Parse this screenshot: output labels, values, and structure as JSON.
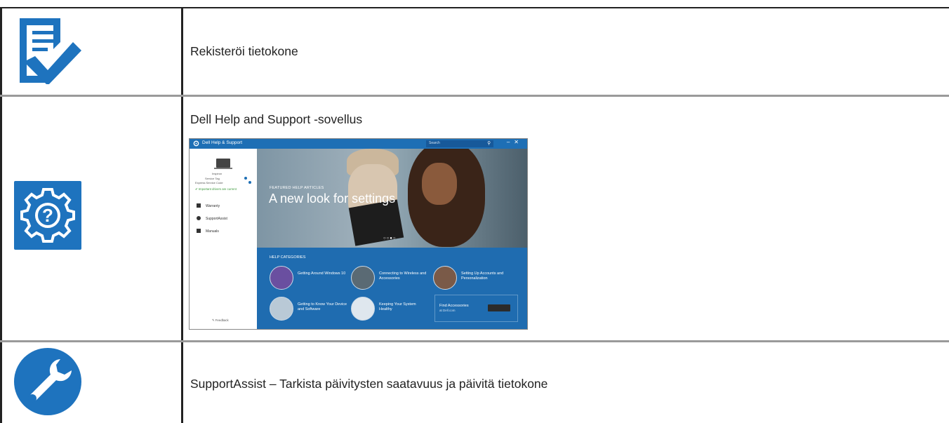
{
  "rows": [
    {
      "text": "Rekisteröi tietokone",
      "icon": "register-checklist-icon"
    },
    {
      "text": "Dell Help and Support -sovellus",
      "icon": "help-gear-icon"
    },
    {
      "text": "SupportAssist – Tarkista päivitysten saatavuus ja päivitä tietokone",
      "icon": "wrench-icon"
    }
  ],
  "app": {
    "title": "Dell Help & Support",
    "search_placeholder": "Search",
    "sidebar": {
      "model": "Inspiron",
      "service_tag": "Service Tag",
      "express_code": "Express Service Code",
      "drivers_status": "Important drivers are current",
      "items": [
        "Warranty",
        "SupportAssist",
        "Manuals"
      ],
      "feedback": "Feedback"
    },
    "hero": {
      "kicker": "FEATURED HELP ARTICLES",
      "title": "A new look for settings",
      "dots": "○○●○"
    },
    "categories": {
      "heading": "HELP CATEGORIES",
      "items": [
        "Getting Around Windows 10",
        "Connecting to Wireless and Accessories",
        "Setting Up Accounts and Personalization",
        "Getting to Know Your Device and Software",
        "Keeping Your System Healthy"
      ],
      "accessories_title": "Find Accessories",
      "accessories_sub": "at Dell.com"
    }
  },
  "colors": {
    "icon_blue": "#1e73be",
    "app_blue": "#1f6cb0"
  }
}
